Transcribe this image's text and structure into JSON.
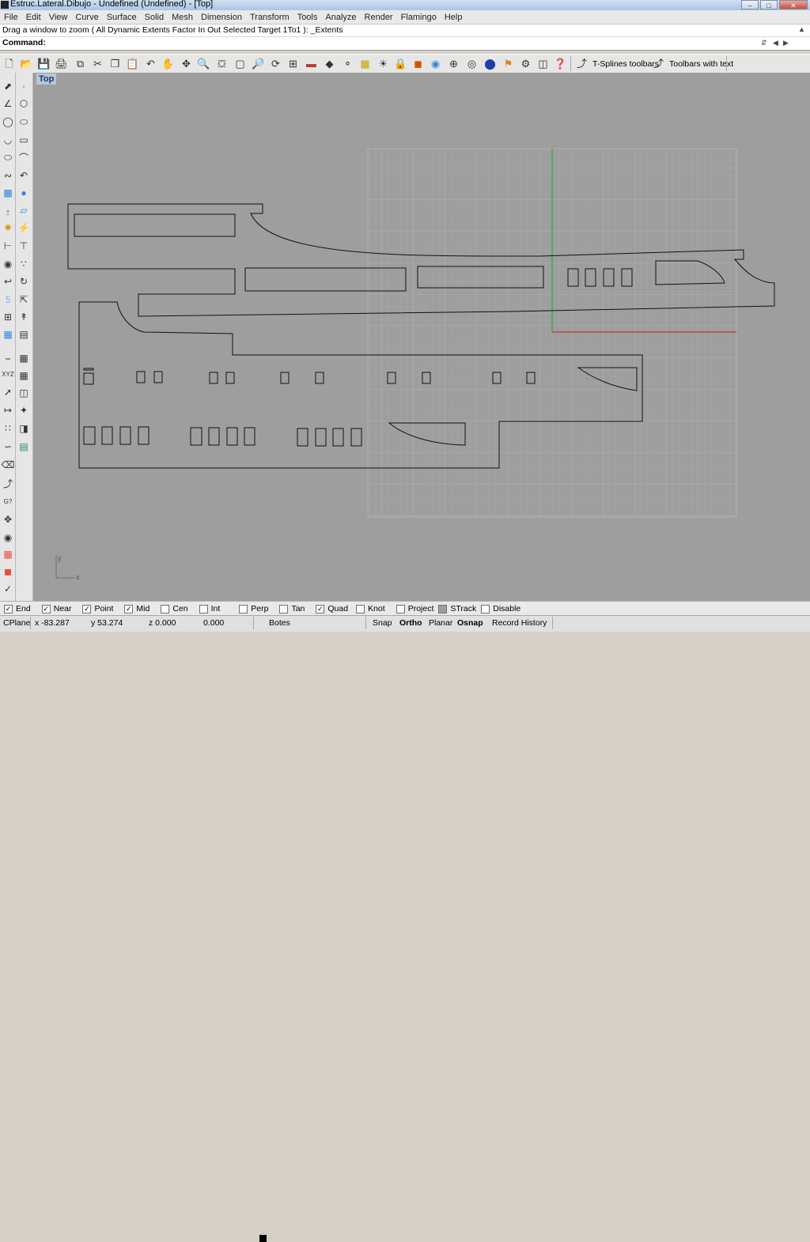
{
  "window": {
    "title": "Estruc.Lateral.Dibujo - Undefined (Undefined) - [Top]"
  },
  "menu": [
    "File",
    "Edit",
    "View",
    "Curve",
    "Surface",
    "Solid",
    "Mesh",
    "Dimension",
    "Transform",
    "Tools",
    "Analyze",
    "Render",
    "Flamingo",
    "Help"
  ],
  "command": {
    "prompt": "Drag a window to zoom ( All  Dynamic  Extents  Factor  In  Out  Selected  Target  1To1 ): _Extents",
    "label": "Command:",
    "value": ""
  },
  "toolbar": {
    "icons": [
      "new-file",
      "open-file",
      "save-file",
      "print",
      "import",
      "cut",
      "copy",
      "paste",
      "undo",
      "pan",
      "rotate-view",
      "zoom-dynamic",
      "zoom-window",
      "zoom-extents",
      "zoom-selected",
      "undo-view",
      "four-viewports",
      "car-object",
      "shaded-object",
      "set-cplane",
      "light-bulb",
      "lock",
      "render-cube",
      "color-wheel",
      "sphere-mesh",
      "wireframe-sphere",
      "blue-sphere",
      "flag-point",
      "gear-settings",
      "group",
      "help"
    ],
    "tsplines_label": "T-Splines toolbars",
    "text_toolbars_label": "Toolbars with text"
  },
  "viewport": {
    "name": "Top",
    "axis_x": "x",
    "axis_y": "y"
  },
  "osnaps": [
    {
      "label": "End",
      "checked": true
    },
    {
      "label": "Near",
      "checked": true
    },
    {
      "label": "Point",
      "checked": true
    },
    {
      "label": "Mid",
      "checked": true
    },
    {
      "label": "Cen",
      "checked": false
    },
    {
      "label": "Int",
      "checked": false
    },
    {
      "label": "Perp",
      "checked": false
    },
    {
      "label": "Tan",
      "checked": false
    },
    {
      "label": "Quad",
      "checked": true
    },
    {
      "label": "Knot",
      "checked": false
    },
    {
      "label": "Project",
      "checked": false
    },
    {
      "label": "STrack",
      "checked": false
    },
    {
      "label": "Disable",
      "checked": false
    }
  ],
  "status": {
    "cplane": "CPlane",
    "x": "x -83.287",
    "y": "y 53.274",
    "z": "z 0.000",
    "distance": "0.000",
    "layer": "Botes",
    "snap": "Snap",
    "ortho": "Ortho",
    "planar": "Planar",
    "osnap": "Osnap",
    "record_history": "Record History"
  },
  "colors": {
    "x_axis": "#c0392b",
    "y_axis": "#2ea84a",
    "viewport_bg": "#9e9e9e",
    "grid": "#a8a8a8",
    "layer_swatch": "#000000"
  }
}
